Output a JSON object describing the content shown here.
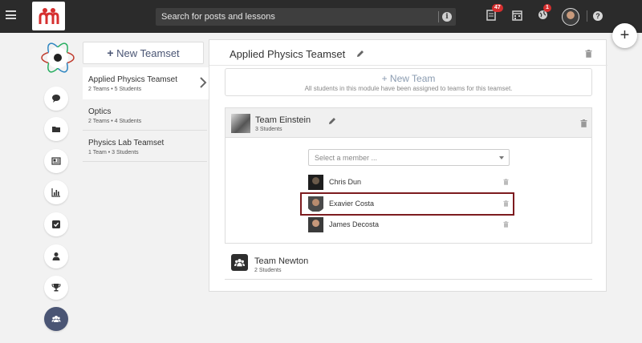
{
  "search": {
    "placeholder": "Search for posts and lessons"
  },
  "topbar": {
    "notifications_badge": "47",
    "globe_badge": "1"
  },
  "fab": {
    "label": "+"
  },
  "sidebar_nav": [
    "chat-icon",
    "folder-icon",
    "newspaper-icon",
    "bar-chart-icon",
    "checkbox-icon",
    "user-icon",
    "trophy-icon",
    "users-icon"
  ],
  "teamsets": {
    "new_button": "New Teamset",
    "new_button_plus": "+",
    "items": [
      {
        "name": "Applied Physics Teamset",
        "meta": "2 Teams • 5 Students"
      },
      {
        "name": "Optics",
        "meta": "2 Teams • 4 Students"
      },
      {
        "name": "Physics Lab Teamset",
        "meta": "1 Team • 3 Students"
      }
    ]
  },
  "panel": {
    "title": "Applied Physics Teamset",
    "new_team_label": "+ New Team",
    "new_team_sub": "All students in this module have been assigned to teams for this teamset.",
    "teams": [
      {
        "name": "Team Einstein",
        "meta": "3 Students",
        "select_placeholder": "Select a member ...",
        "members": [
          "Chris Dun",
          "Exavier Costa",
          "James Decosta"
        ]
      },
      {
        "name": "Team Newton",
        "meta": "2 Students"
      }
    ]
  },
  "colors": {
    "topbar": "#2b2b2b",
    "accent": "#4a5574",
    "highlight": "#7d1b1f",
    "badge": "#d62f2f"
  }
}
